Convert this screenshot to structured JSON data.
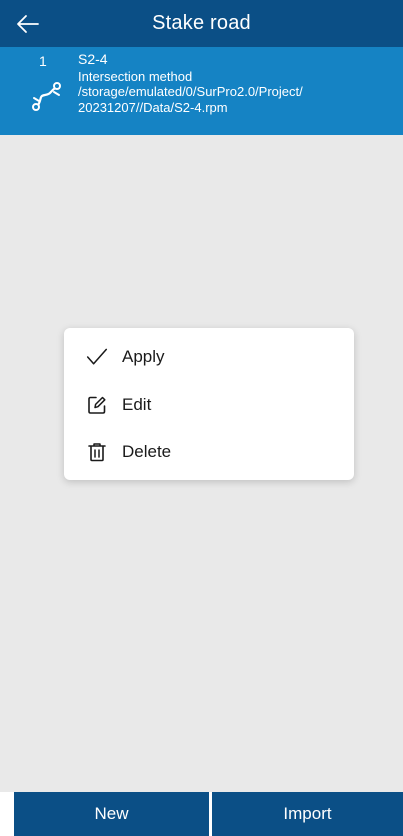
{
  "header": {
    "title": "Stake road",
    "back_icon": "arrow-left-icon"
  },
  "road_list": {
    "items": [
      {
        "index": "1",
        "name": "S2-4",
        "method": "Intersection method",
        "path_line1": "/storage/emulated/0/SurPro2.0/Project/",
        "path_line2": "20231207//Data/S2-4.rpm",
        "icon": "road-route-icon"
      }
    ]
  },
  "context_menu": {
    "items": [
      {
        "label": "Apply",
        "icon": "checkmark-icon"
      },
      {
        "label": "Edit",
        "icon": "edit-icon"
      },
      {
        "label": "Delete",
        "icon": "trash-icon"
      }
    ]
  },
  "bottom_bar": {
    "new_label": "New",
    "import_label": "Import"
  },
  "colors": {
    "header_bg": "#0b4f86",
    "selected_item_bg": "#1583c4",
    "page_bg": "#e9e9e9",
    "button_bg": "#0b4f86"
  }
}
